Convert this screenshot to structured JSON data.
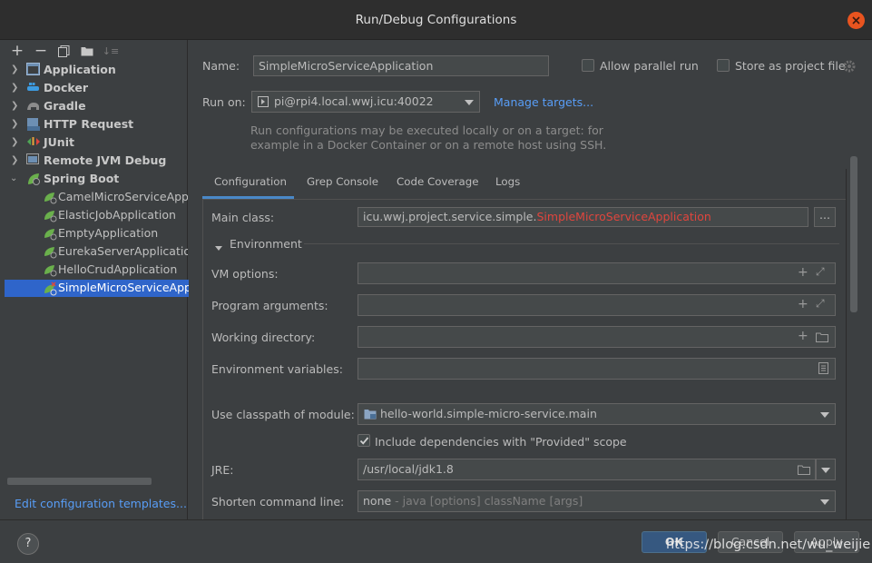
{
  "window": {
    "title": "Run/Debug Configurations"
  },
  "toolbar": {
    "add": "+",
    "remove": "−",
    "sort": "↓≡"
  },
  "tree": {
    "groups": [
      {
        "label": "Application",
        "icon": "application-icon"
      },
      {
        "label": "Docker",
        "icon": "docker-icon"
      },
      {
        "label": "Gradle",
        "icon": "gradle-icon"
      },
      {
        "label": "HTTP Request",
        "icon": "http-request-icon"
      },
      {
        "label": "JUnit",
        "icon": "junit-icon"
      },
      {
        "label": "Remote JVM Debug",
        "icon": "remote-debug-icon"
      },
      {
        "label": "Spring Boot",
        "icon": "spring-boot-icon"
      }
    ],
    "spring_children": [
      "CamelMicroServiceApplication",
      "ElasticJobApplication",
      "EmptyApplication",
      "EurekaServerApplication",
      "HelloCrudApplication",
      "SimpleMicroServiceApplication"
    ]
  },
  "left": {
    "edit_templates": "Edit configuration templates..."
  },
  "form": {
    "name_label": "Name:",
    "name_value": "SimpleMicroServiceApplication",
    "allow_parallel": "Allow parallel run",
    "store_project": "Store as project file",
    "run_on_label": "Run on:",
    "run_on_value": "pi@rpi4.local.wwj.icu:40022",
    "manage_targets": "Manage targets...",
    "hint_line1": "Run configurations may be executed locally or on a target: for",
    "hint_line2": "example in a Docker Container or on a remote host using SSH."
  },
  "tabs": [
    "Configuration",
    "Grep Console",
    "Code Coverage",
    "Logs"
  ],
  "config": {
    "main_class_label": "Main class:",
    "main_class_pkg": "icu.wwj.project.service.simple.",
    "main_class_name": "SimpleMicroServiceApplication",
    "more_button": "...",
    "environment": "Environment",
    "vm_options": "VM options:",
    "program_args": "Program arguments:",
    "working_dir": "Working directory:",
    "env_vars": "Environment variables:",
    "classpath_label": "Use classpath of module:",
    "classpath_value": "hello-world.simple-micro-service.main",
    "include_deps": "Include dependencies with \"Provided\" scope",
    "jre_label": "JRE:",
    "jre_value": "/usr/local/jdk1.8",
    "shorten_label": "Shorten command line:",
    "shorten_value": "none",
    "shorten_hint": " - java [options] className [args]"
  },
  "buttons": {
    "help": "?",
    "ok": "OK",
    "cancel": "Cancel",
    "apply": "Apply"
  },
  "watermark": "https://blog.csdn.net/wu_weijie",
  "colors": {
    "accent": "#2f65ca",
    "link": "#589df6",
    "error": "#e0453d",
    "close": "#e9541f"
  }
}
